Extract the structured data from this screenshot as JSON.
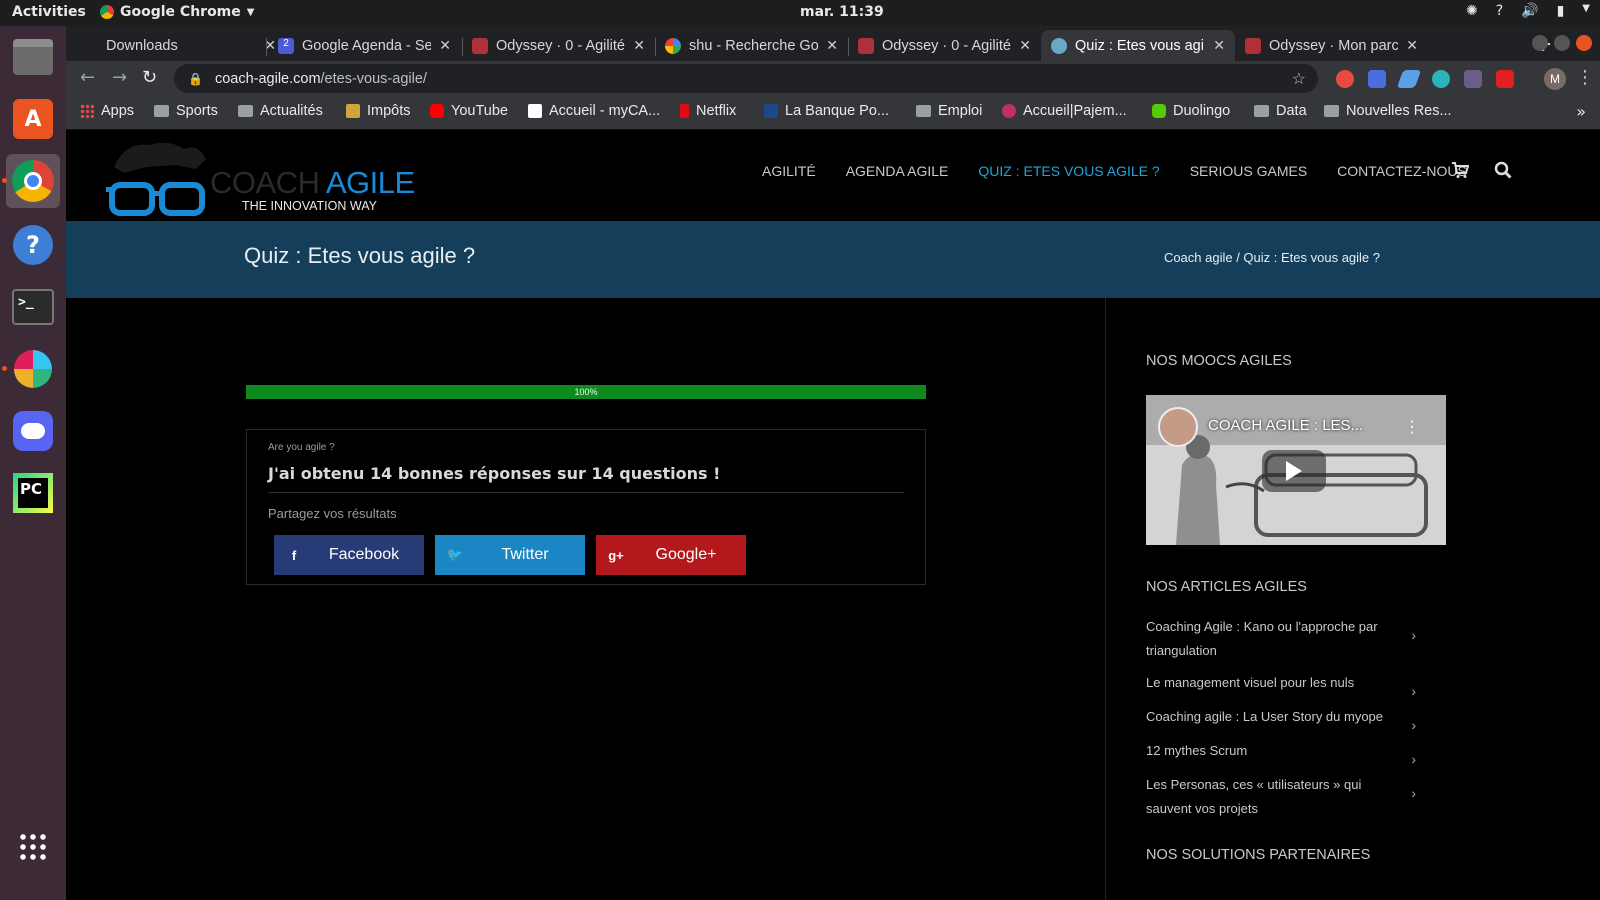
{
  "os": {
    "activities": "Activities",
    "app_name": "Google Chrome",
    "clock": "mar. 11:39"
  },
  "browser": {
    "tabs": [
      {
        "title": "Downloads",
        "icon_color": "#202124"
      },
      {
        "title": "Google Agenda - Se",
        "icon_color": "#4f5bd5"
      },
      {
        "title": "Odyssey · 0 - Agilité",
        "icon_color": "#b0303a"
      },
      {
        "title": "shu - Recherche Goo",
        "icon_color": "#ffffff"
      },
      {
        "title": "Odyssey · 0 - Agilité",
        "icon_color": "#b0303a"
      },
      {
        "title": "Quiz : Etes vous agi",
        "icon_color": "#6aa8c8"
      },
      {
        "title": "Odyssey · Mon parc",
        "icon_color": "#b0303a"
      }
    ],
    "active_tab_index": 5,
    "url_host": "coach-agile.com",
    "url_path": "/etes-vous-agile/",
    "profile_initial": "M",
    "bookmarks": [
      {
        "label": "Apps",
        "kind": "apps",
        "color": "#e8453c"
      },
      {
        "label": "Sports",
        "kind": "folder"
      },
      {
        "label": "Actualités",
        "kind": "folder"
      },
      {
        "label": "Impôts",
        "kind": "icon",
        "color": "#d2a53b"
      },
      {
        "label": "YouTube",
        "kind": "icon",
        "color": "#ff0000"
      },
      {
        "label": "Accueil - myCA...",
        "kind": "icon",
        "color": "#ffffff"
      },
      {
        "label": "Netflix",
        "kind": "icon",
        "color": "#e50914"
      },
      {
        "label": "La Banque Po...",
        "kind": "icon",
        "color": "#1a4a8a"
      },
      {
        "label": "Emploi",
        "kind": "folder"
      },
      {
        "label": "Accueil|Pajem...",
        "kind": "icon",
        "color": "#c0306a"
      },
      {
        "label": "Duolingo",
        "kind": "icon",
        "color": "#58cc02"
      },
      {
        "label": "Data",
        "kind": "folder"
      },
      {
        "label": "Nouvelles Res...",
        "kind": "folder"
      }
    ]
  },
  "site": {
    "logo_coach": "COACH",
    "logo_agile": "AGILE",
    "logo_tagline": "THE INNOVATION WAY",
    "nav": [
      {
        "label": "AGILITÉ",
        "current": false
      },
      {
        "label": "AGENDA AGILE",
        "current": false
      },
      {
        "label": "QUIZ : ETES VOUS AGILE ?",
        "current": true
      },
      {
        "label": "SERIOUS GAMES",
        "current": false
      },
      {
        "label": "CONTACTEZ-NOUS",
        "current": false
      }
    ],
    "page_title": "Quiz : Etes vous agile ?",
    "breadcrumb": "Coach agile / Quiz : Etes vous agile ?"
  },
  "quiz": {
    "progress_label": "100%",
    "progress_fraction": 1.0,
    "kicker": "Are you agile ?",
    "result": "J'ai obtenu 14 bonnes réponses sur 14 questions !",
    "share_label": "Partagez vos résultats",
    "share_buttons": [
      {
        "label": "Facebook",
        "icon": "f",
        "color": "#273b76"
      },
      {
        "label": "Twitter",
        "icon": "t",
        "color": "#1b86c4"
      },
      {
        "label": "Google+",
        "icon": "g+",
        "color": "#b3191c"
      }
    ]
  },
  "sidebar": {
    "moocs_heading": "NOS MOOCS AGILES",
    "video_title": "COACH AGILE : LES...",
    "articles_heading": "NOS ARTICLES AGILES",
    "articles": [
      "Coaching Agile : Kano ou l'approche par triangulation",
      "Le management visuel pour les nuls",
      "Coaching agile : La User Story du myope",
      "12 mythes Scrum",
      "Les Personas, ces « utilisateurs » qui sauvent vos projets"
    ],
    "partners_heading": "NOS SOLUTIONS PARTENAIRES"
  }
}
